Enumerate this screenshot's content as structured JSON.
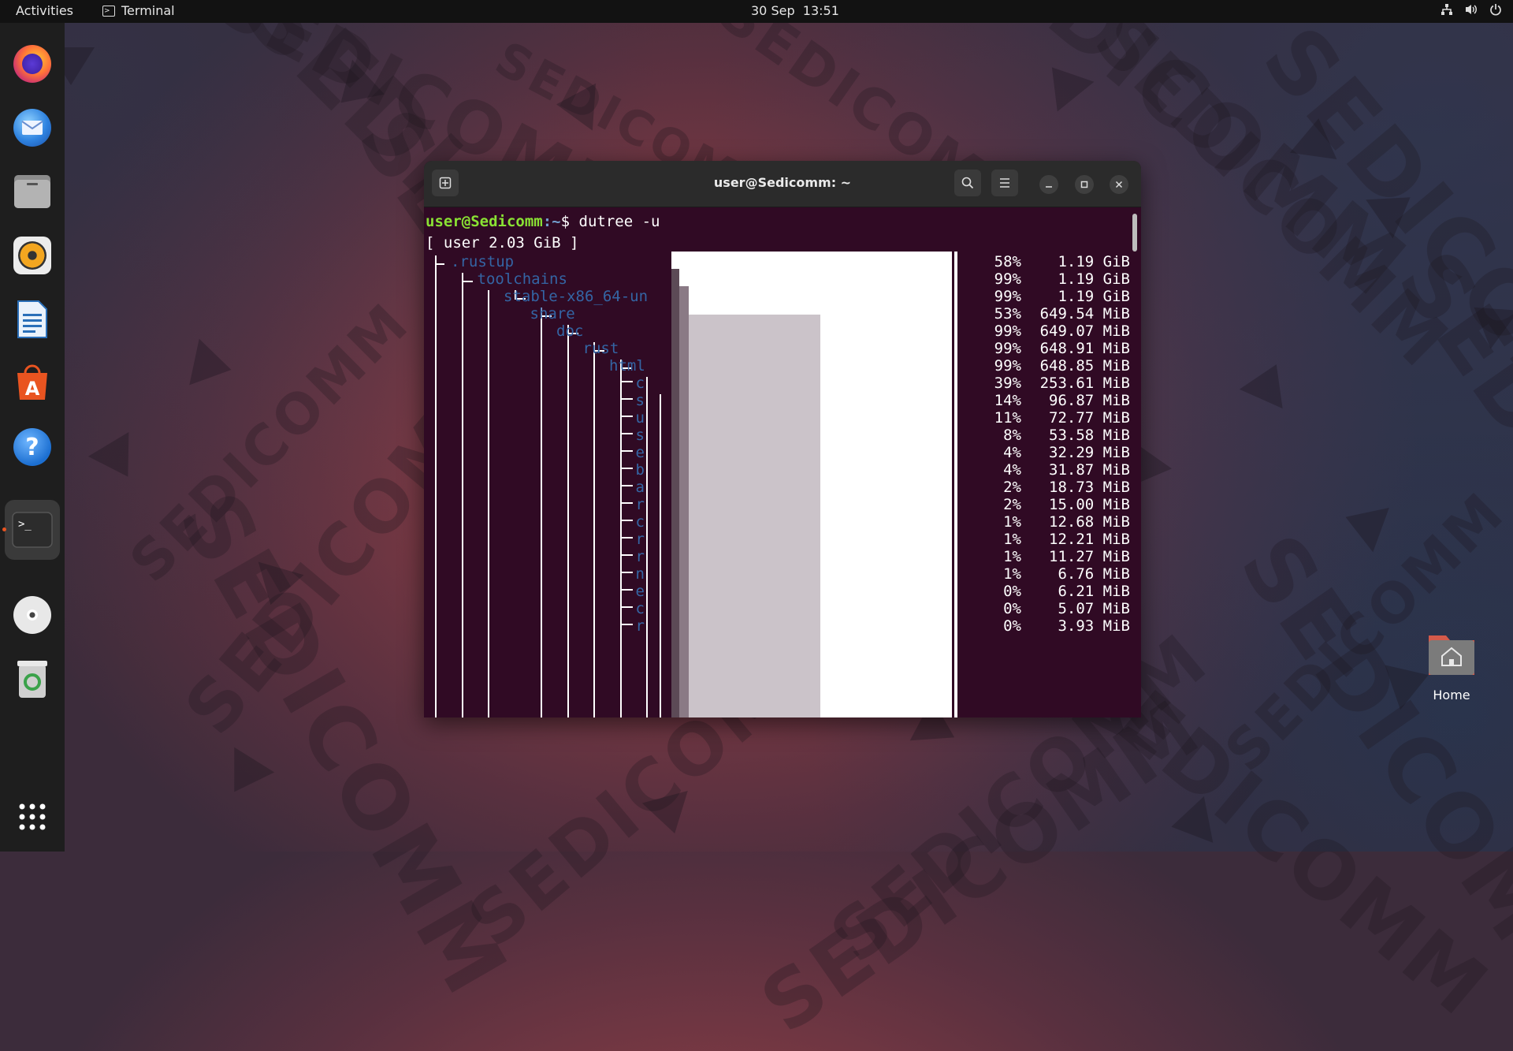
{
  "topbar": {
    "activities": "Activities",
    "app_name": "Terminal",
    "date": "30 Sep",
    "time": "13:51",
    "tray_icons": [
      "network-icon",
      "volume-icon",
      "power-icon"
    ]
  },
  "dock": {
    "items": [
      "firefox",
      "thunderbird",
      "files",
      "rhythmbox",
      "libreoffice-writer",
      "software",
      "help",
      "terminal",
      "disc",
      "trash"
    ],
    "show_apps": "show-applications"
  },
  "desktop": {
    "home_label": "Home",
    "watermark": "SEDICOMM"
  },
  "terminal": {
    "title": "user@Sedicomm: ~",
    "prompt_user": "user@Sedicomm",
    "prompt_path": ":~",
    "prompt_symbol": "$",
    "command": "dutree -u",
    "root_line": "[ user 2.03 GiB ]",
    "rows": [
      {
        "name": ".rustup",
        "pct": "58%",
        "size": "1.19 GiB"
      },
      {
        "name": "toolchains",
        "pct": "99%",
        "size": "1.19 GiB"
      },
      {
        "name": "stable-x86_64-un",
        "pct": "99%",
        "size": "1.19 GiB"
      },
      {
        "name": "share",
        "pct": "53%",
        "size": "649.54 MiB"
      },
      {
        "name": "doc",
        "pct": "99%",
        "size": "649.07 MiB"
      },
      {
        "name": "rust",
        "pct": "99%",
        "size": "648.91 MiB"
      },
      {
        "name": "html",
        "pct": "99%",
        "size": "648.85 MiB"
      },
      {
        "name": "c",
        "pct": "39%",
        "size": "253.61 MiB"
      },
      {
        "name": "s",
        "pct": "14%",
        "size": "96.87 MiB"
      },
      {
        "name": "u",
        "pct": "11%",
        "size": "72.77 MiB"
      },
      {
        "name": "s",
        "pct": "8%",
        "size": "53.58 MiB"
      },
      {
        "name": "e",
        "pct": "4%",
        "size": "32.29 MiB"
      },
      {
        "name": "b",
        "pct": "4%",
        "size": "31.87 MiB"
      },
      {
        "name": "a",
        "pct": "2%",
        "size": "18.73 MiB"
      },
      {
        "name": "r",
        "pct": "2%",
        "size": "15.00 MiB"
      },
      {
        "name": "c",
        "pct": "1%",
        "size": "12.68 MiB"
      },
      {
        "name": "r",
        "pct": "1%",
        "size": "12.21 MiB"
      },
      {
        "name": "r",
        "pct": "1%",
        "size": "11.27 MiB"
      },
      {
        "name": "n",
        "pct": "1%",
        "size": "6.76 MiB"
      },
      {
        "name": "e",
        "pct": "0%",
        "size": "6.21 MiB"
      },
      {
        "name": "c",
        "pct": "0%",
        "size": "5.07 MiB"
      },
      {
        "name": "r",
        "pct": "0%",
        "size": "3.93 MiB"
      }
    ]
  },
  "colors": {
    "terminal_bg": "#300a24",
    "prompt_user": "#8ae234",
    "tree_name": "#3465a4",
    "accent": "#e95420"
  }
}
